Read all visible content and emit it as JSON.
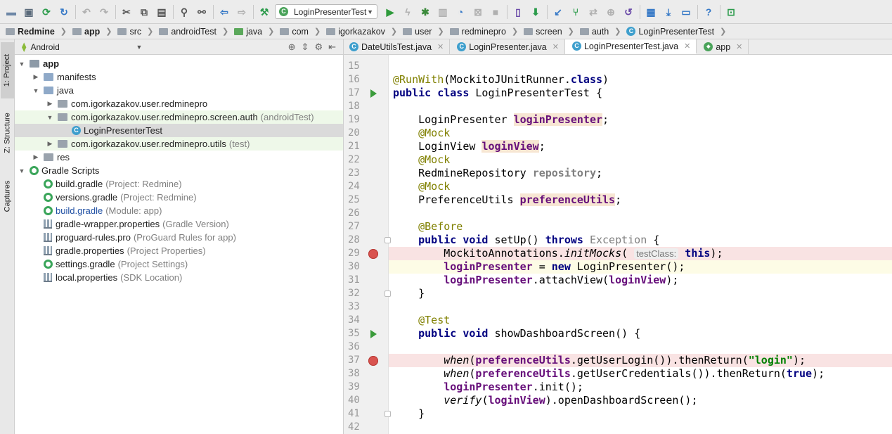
{
  "toolbar": {
    "run_config": "LoginPresenterTest",
    "icons": [
      "folder-open",
      "save",
      "sync",
      "refresh",
      "undo",
      "redo",
      "cut",
      "copy",
      "paste",
      "find",
      "replace",
      "back",
      "forward",
      "build",
      "run",
      "debug-lightning",
      "debug",
      "coverage",
      "profile",
      "apply-changes",
      "stop",
      "avd-manager",
      "sdk-manager",
      "vcs-update",
      "vcs-commit",
      "vcs-compare",
      "vcs-revert",
      "project-structure",
      "sdk-download",
      "help",
      "mirror-device"
    ]
  },
  "navbar": {
    "crumbs": [
      "Redmine",
      "app",
      "src",
      "androidTest",
      "java",
      "com",
      "igorkazakov",
      "user",
      "redminepro",
      "screen",
      "auth",
      "LoginPresenterTest"
    ]
  },
  "left_strip": {
    "project": "1: Project",
    "structure": "Z: Structure",
    "captures": "Captures"
  },
  "project_panel": {
    "view": "Android",
    "tree": [
      {
        "label": "app",
        "suffix": "",
        "indent": 0,
        "expanded": "open",
        "icon": "module",
        "bold": true
      },
      {
        "label": "manifests",
        "suffix": "",
        "indent": 1,
        "expanded": "closed",
        "icon": "folder"
      },
      {
        "label": "java",
        "suffix": "",
        "indent": 1,
        "expanded": "open",
        "icon": "folder"
      },
      {
        "label": "com.igorkazakov.user.redminepro",
        "suffix": "",
        "indent": 2,
        "expanded": "closed",
        "icon": "package"
      },
      {
        "label": "com.igorkazakov.user.redminepro.screen.auth",
        "suffix": "(androidTest)",
        "indent": 2,
        "expanded": "open",
        "icon": "package",
        "highlight": "green"
      },
      {
        "label": "LoginPresenterTest",
        "suffix": "",
        "indent": 3,
        "expanded": "",
        "icon": "class",
        "highlight": "selected"
      },
      {
        "label": "com.igorkazakov.user.redminepro.utils",
        "suffix": "(test)",
        "indent": 2,
        "expanded": "closed",
        "icon": "package",
        "highlight": "green"
      },
      {
        "label": "res",
        "suffix": "",
        "indent": 1,
        "expanded": "closed",
        "icon": "res"
      },
      {
        "label": "Gradle Scripts",
        "suffix": "",
        "indent": 0,
        "expanded": "open",
        "icon": "gradle"
      },
      {
        "label": "build.gradle",
        "suffix": "(Project: Redmine)",
        "indent": 1,
        "expanded": "",
        "icon": "gradle"
      },
      {
        "label": "versions.gradle",
        "suffix": "(Project: Redmine)",
        "indent": 1,
        "expanded": "",
        "icon": "gradle"
      },
      {
        "label": "build.gradle",
        "suffix": "(Module: app)",
        "indent": 1,
        "expanded": "",
        "icon": "gradle",
        "blue": true
      },
      {
        "label": "gradle-wrapper.properties",
        "suffix": "(Gradle Version)",
        "indent": 1,
        "expanded": "",
        "icon": "props"
      },
      {
        "label": "proguard-rules.pro",
        "suffix": "(ProGuard Rules for app)",
        "indent": 1,
        "expanded": "",
        "icon": "props"
      },
      {
        "label": "gradle.properties",
        "suffix": "(Project Properties)",
        "indent": 1,
        "expanded": "",
        "icon": "props"
      },
      {
        "label": "settings.gradle",
        "suffix": "(Project Settings)",
        "indent": 1,
        "expanded": "",
        "icon": "gradle"
      },
      {
        "label": "local.properties",
        "suffix": "(SDK Location)",
        "indent": 1,
        "expanded": "",
        "icon": "props"
      }
    ]
  },
  "editor": {
    "tabs": [
      {
        "label": "DateUtilsTest.java",
        "active": false
      },
      {
        "label": "LoginPresenter.java",
        "active": false
      },
      {
        "label": "LoginPresenterTest.java",
        "active": true
      },
      {
        "label": "app",
        "active": false
      }
    ],
    "lines": [
      {
        "n": 15,
        "mark": "",
        "bg": "",
        "t": []
      },
      {
        "n": 16,
        "mark": "",
        "bg": "",
        "t": [
          [
            "an",
            "@RunWith"
          ],
          [
            "",
            "(MockitoJUnitRunner."
          ],
          [
            "kw",
            "class"
          ],
          [
            "",
            ")"
          ]
        ]
      },
      {
        "n": 17,
        "mark": "run2",
        "bg": "",
        "t": [
          [
            "kw",
            "public class "
          ],
          [
            "",
            "LoginPresenterTest {"
          ]
        ]
      },
      {
        "n": 18,
        "mark": "",
        "bg": "",
        "t": []
      },
      {
        "n": 19,
        "mark": "",
        "bg": "",
        "t": [
          [
            "",
            "    LoginPresenter "
          ],
          [
            "fld fhl",
            "loginPresenter"
          ],
          [
            "",
            ";"
          ]
        ]
      },
      {
        "n": 20,
        "mark": "",
        "bg": "",
        "t": [
          [
            "an",
            "    @Mock"
          ]
        ]
      },
      {
        "n": 21,
        "mark": "",
        "bg": "",
        "t": [
          [
            "",
            "    LoginView "
          ],
          [
            "fld fhl",
            "loginView"
          ],
          [
            "",
            ";"
          ]
        ]
      },
      {
        "n": 22,
        "mark": "",
        "bg": "",
        "t": [
          [
            "an",
            "    @Mock"
          ]
        ]
      },
      {
        "n": 23,
        "mark": "",
        "bg": "",
        "t": [
          [
            "",
            "    RedmineRepository "
          ],
          [
            "fld gry",
            "repository"
          ],
          [
            "",
            ";"
          ]
        ]
      },
      {
        "n": 24,
        "mark": "",
        "bg": "",
        "t": [
          [
            "an",
            "    @Mock"
          ]
        ]
      },
      {
        "n": 25,
        "mark": "",
        "bg": "",
        "t": [
          [
            "",
            "    PreferenceUtils "
          ],
          [
            "fld fhl",
            "preferenceUtils"
          ],
          [
            "",
            ";"
          ]
        ]
      },
      {
        "n": 26,
        "mark": "",
        "bg": "",
        "t": []
      },
      {
        "n": 27,
        "mark": "",
        "bg": "",
        "t": [
          [
            "an",
            "    @Before"
          ]
        ]
      },
      {
        "n": 28,
        "mark": "fold",
        "bg": "",
        "t": [
          [
            "kw",
            "    public void "
          ],
          [
            "",
            "setUp() "
          ],
          [
            "kw",
            "throws "
          ],
          [
            "gry",
            "Exception"
          ],
          [
            "",
            " {"
          ]
        ]
      },
      {
        "n": 29,
        "mark": "bp",
        "bg": "bp",
        "t": [
          [
            "",
            "        MockitoAnnotations."
          ],
          [
            "it",
            "initMocks"
          ],
          [
            "",
            "( "
          ],
          [
            "hint",
            "testClass:"
          ],
          [
            "",
            " "
          ],
          [
            "kw",
            "this"
          ],
          [
            "",
            ");"
          ]
        ]
      },
      {
        "n": 30,
        "mark": "",
        "bg": "cur",
        "t": [
          [
            "",
            "        "
          ],
          [
            "fld",
            "loginPresenter"
          ],
          [
            "",
            " = "
          ],
          [
            "kw",
            "new "
          ],
          [
            "",
            "LoginPresenter();"
          ]
        ]
      },
      {
        "n": 31,
        "mark": "",
        "bg": "",
        "t": [
          [
            "",
            "        "
          ],
          [
            "fld",
            "loginPresenter"
          ],
          [
            "",
            ".attachView("
          ],
          [
            "fld",
            "loginView"
          ],
          [
            "",
            ");"
          ]
        ]
      },
      {
        "n": 32,
        "mark": "fold",
        "bg": "",
        "t": [
          [
            "",
            "    }"
          ]
        ]
      },
      {
        "n": 33,
        "mark": "",
        "bg": "",
        "t": []
      },
      {
        "n": 34,
        "mark": "",
        "bg": "",
        "t": [
          [
            "an",
            "    @Test"
          ]
        ]
      },
      {
        "n": 35,
        "mark": "run",
        "bg": "",
        "t": [
          [
            "kw",
            "    public void "
          ],
          [
            "",
            "showDashboardScreen() {"
          ]
        ]
      },
      {
        "n": 36,
        "mark": "",
        "bg": "",
        "t": []
      },
      {
        "n": 37,
        "mark": "bp",
        "bg": "bp",
        "t": [
          [
            "",
            "        "
          ],
          [
            "it",
            "when"
          ],
          [
            "",
            "("
          ],
          [
            "fld",
            "preferenceUtils"
          ],
          [
            "",
            ".getUserLogin()).thenReturn("
          ],
          [
            "st",
            "\"login\""
          ],
          [
            "",
            ");"
          ]
        ]
      },
      {
        "n": 38,
        "mark": "",
        "bg": "",
        "t": [
          [
            "",
            "        "
          ],
          [
            "it",
            "when"
          ],
          [
            "",
            "("
          ],
          [
            "fld",
            "preferenceUtils"
          ],
          [
            "",
            ".getUserCredentials()).thenReturn("
          ],
          [
            "kw",
            "true"
          ],
          [
            "",
            ");"
          ]
        ]
      },
      {
        "n": 39,
        "mark": "",
        "bg": "",
        "t": [
          [
            "",
            "        "
          ],
          [
            "fld",
            "loginPresenter"
          ],
          [
            "",
            ".init();"
          ]
        ]
      },
      {
        "n": 40,
        "mark": "",
        "bg": "",
        "t": [
          [
            "",
            "        "
          ],
          [
            "it",
            "verify"
          ],
          [
            "",
            "("
          ],
          [
            "fld",
            "loginView"
          ],
          [
            "",
            ").openDashboardScreen();"
          ]
        ]
      },
      {
        "n": 41,
        "mark": "fold",
        "bg": "",
        "t": [
          [
            "",
            "    }"
          ]
        ]
      },
      {
        "n": 42,
        "mark": "",
        "bg": "",
        "t": []
      }
    ]
  },
  "colors": {
    "keyword": "#000080",
    "annotation": "#808000",
    "field": "#660e7a",
    "string": "#008000",
    "breakpoint": "#d9534f"
  }
}
